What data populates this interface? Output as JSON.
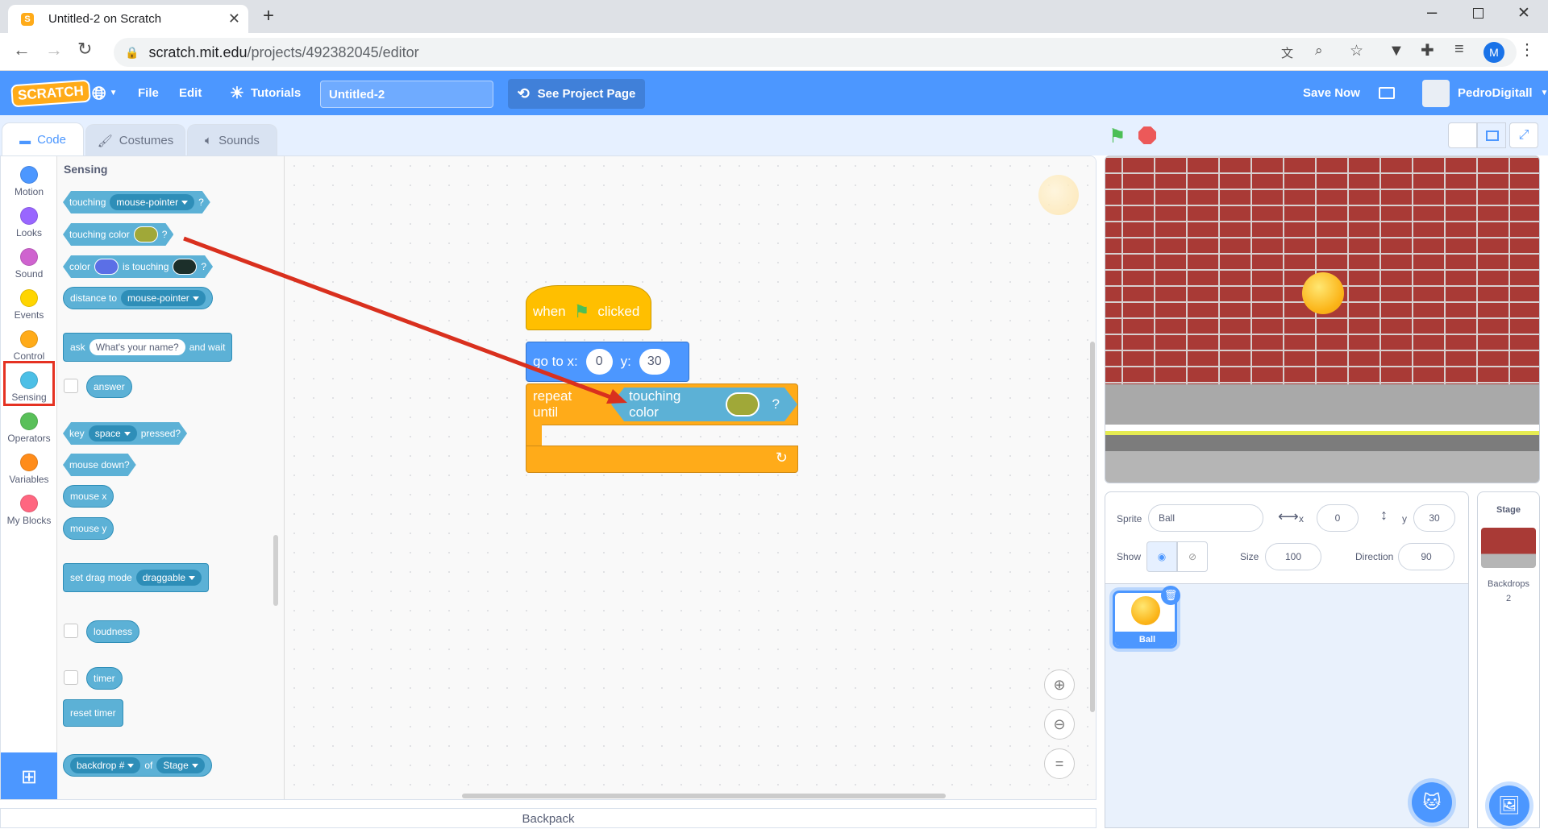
{
  "browser": {
    "tab_title": "Untitled-2 on Scratch",
    "url_host": "scratch.mit.edu",
    "url_path": "/projects/492382045/editor",
    "profile_initial": "M"
  },
  "menubar": {
    "logo": "SCRATCH",
    "file": "File",
    "edit": "Edit",
    "tutorials": "Tutorials",
    "project_title": "Untitled-2",
    "see_project": "See Project Page",
    "save_now": "Save Now",
    "username": "PedroDigitall"
  },
  "editor_tabs": {
    "code": "Code",
    "costumes": "Costumes",
    "sounds": "Sounds"
  },
  "categories": [
    {
      "label": "Motion",
      "color": "#4c97ff"
    },
    {
      "label": "Looks",
      "color": "#9966ff"
    },
    {
      "label": "Sound",
      "color": "#cf63cf"
    },
    {
      "label": "Events",
      "color": "#ffd500"
    },
    {
      "label": "Control",
      "color": "#ffab19"
    },
    {
      "label": "Sensing",
      "color": "#4cbfe6"
    },
    {
      "label": "Operators",
      "color": "#59c059"
    },
    {
      "label": "Variables",
      "color": "#ff8c1a"
    },
    {
      "label": "My Blocks",
      "color": "#ff6680"
    }
  ],
  "palette": {
    "heading": "Sensing",
    "touching": "touching",
    "mouse_pointer": "mouse-pointer",
    "q": "?",
    "touching_color": "touching color",
    "touch_color_swatch": "#a0a838",
    "color": "color",
    "color_swatch1": "#5b6fe6",
    "is_touching": "is touching",
    "color_swatch2": "#1c2f2a",
    "distance_to": "distance to",
    "ask": "ask",
    "ask_default": "What's your name?",
    "and_wait": "and wait",
    "answer": "answer",
    "key": "key",
    "space": "space",
    "pressed": "pressed?",
    "mouse_down": "mouse down?",
    "mouse_x": "mouse x",
    "mouse_y": "mouse y",
    "set_drag_mode": "set drag mode",
    "draggable": "draggable",
    "loudness": "loudness",
    "timer": "timer",
    "reset_timer": "reset timer",
    "backdrop_num": "backdrop #",
    "of": "of",
    "stage": "Stage"
  },
  "script": {
    "when": "when",
    "clicked": "clicked",
    "go_to_x": "go to x:",
    "x_val": "0",
    "y_label": "y:",
    "y_val": "30",
    "repeat_until": "repeat until",
    "touching_color": "touching color",
    "q": "?"
  },
  "sprite_info": {
    "sprite_label": "Sprite",
    "sprite_name": "Ball",
    "x_label": "x",
    "x": "0",
    "y_label": "y",
    "y": "30",
    "show_label": "Show",
    "size_label": "Size",
    "size": "100",
    "direction_label": "Direction",
    "direction": "90"
  },
  "sprites": [
    {
      "name": "Ball"
    }
  ],
  "stage_pane": {
    "title": "Stage",
    "backdrops_label": "Backdrops",
    "backdrops_count": "2"
  },
  "backpack": "Backpack"
}
